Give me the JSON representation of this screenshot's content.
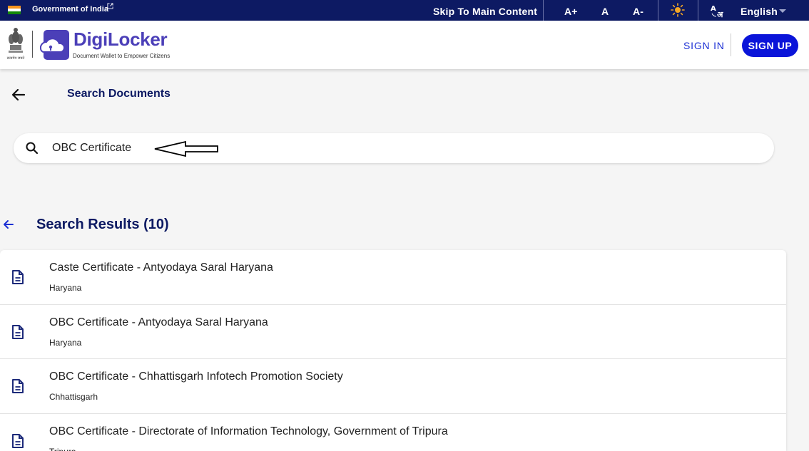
{
  "govbar": {
    "gov_label": "Government of India",
    "skip_label": "Skip To Main Content",
    "font_increase": "A+",
    "font_normal": "A",
    "font_decrease": "A-",
    "language": "English"
  },
  "header": {
    "logo_title": "DigiLocker",
    "logo_subtitle": "Document Wallet to Empower Citizens",
    "emblem_text": "सत्यमेव जयते",
    "signin_label": "SIGN IN",
    "signup_label": "SIGN UP"
  },
  "page": {
    "title": "Search Documents",
    "search_value": "OBC Certificate",
    "results_heading": "Search Results (10)"
  },
  "results": [
    {
      "name": "Caste Certificate - Antyodaya Saral Haryana",
      "state": "Haryana"
    },
    {
      "name": "OBC Certificate - Antyodaya Saral Haryana",
      "state": "Haryana"
    },
    {
      "name": "OBC Certificate - Chhattisgarh Infotech Promotion Society",
      "state": "Chhattisgarh"
    },
    {
      "name": "OBC Certificate - Directorate of Information Technology, Government of Tripura",
      "state": "Tripura"
    }
  ],
  "colors": {
    "govbar_bg": "#0d1a63",
    "brand_purple": "#4b3fb8",
    "signup_bg": "#0a14d9",
    "heading": "#0d1a63"
  },
  "icons": [
    "flag-icon",
    "external-link-icon",
    "brightness-icon",
    "translate-icon",
    "back-arrow-icon",
    "search-icon",
    "document-icon"
  ]
}
